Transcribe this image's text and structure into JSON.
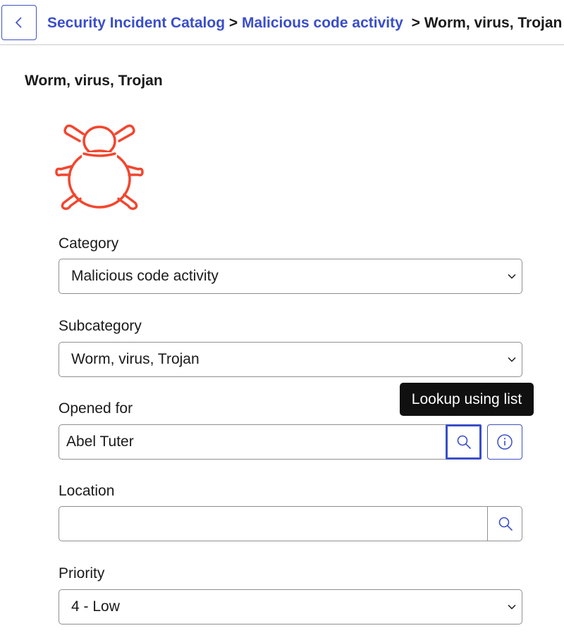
{
  "header": {
    "back_label": "",
    "breadcrumb": [
      {
        "label": "Security Incident Catalog",
        "link": true
      },
      {
        "label": "Malicious code activity",
        "link": true
      },
      {
        "label": "Worm, virus, Trojan",
        "link": false
      }
    ],
    "separator": ">"
  },
  "page": {
    "title": "Worm, virus, Trojan",
    "icon": "bug-icon",
    "accent_color": "#f2462e",
    "link_color": "#3a4ec9"
  },
  "form": {
    "category": {
      "label": "Category",
      "value": "Malicious code activity"
    },
    "subcategory": {
      "label": "Subcategory",
      "value": "Worm, virus, Trojan"
    },
    "opened_for": {
      "label": "Opened for",
      "value": "Abel Tuter",
      "tooltip": "Lookup using list"
    },
    "location": {
      "label": "Location",
      "value": ""
    },
    "priority": {
      "label": "Priority",
      "value": "4 - Low"
    }
  }
}
